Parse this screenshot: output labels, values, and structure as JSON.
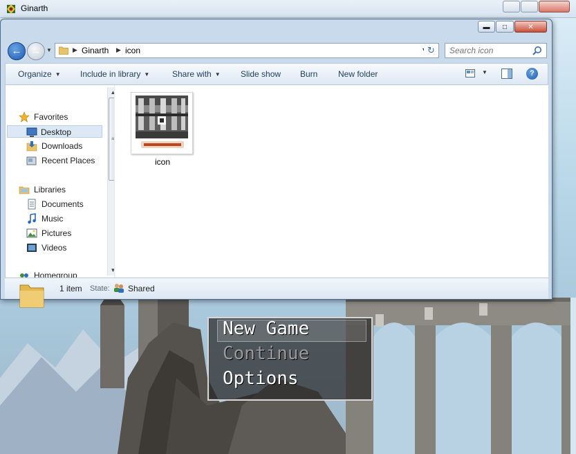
{
  "background_window": {
    "title": "Ginarth",
    "menu": {
      "options": [
        "New Game",
        "Continue",
        "Options"
      ],
      "selected": "New Game",
      "disabled": [
        "Continue"
      ]
    }
  },
  "explorer": {
    "address": {
      "crumbs": [
        "Ginarth",
        "icon"
      ]
    },
    "search": {
      "placeholder": "Search icon"
    },
    "toolbar": {
      "organize": "Organize",
      "include_in_library": "Include in library",
      "share_with": "Share with",
      "slide_show": "Slide show",
      "burn": "Burn",
      "new_folder": "New folder"
    },
    "nav_pane": {
      "favorites": "Favorites",
      "desktop": "Desktop",
      "downloads": "Downloads",
      "recent_places": "Recent Places",
      "libraries": "Libraries",
      "documents": "Documents",
      "music": "Music",
      "pictures": "Pictures",
      "videos": "Videos",
      "homegroup": "Homegroup"
    },
    "files": [
      {
        "name": "icon",
        "type": "image"
      }
    ],
    "details": {
      "item_count": "1 item",
      "state_label": "State:",
      "state_value": "Shared"
    }
  },
  "colors": {
    "accent": "#1d5bb4",
    "selection": "#dce8f5",
    "toolbar_text": "#1e3c5a"
  }
}
